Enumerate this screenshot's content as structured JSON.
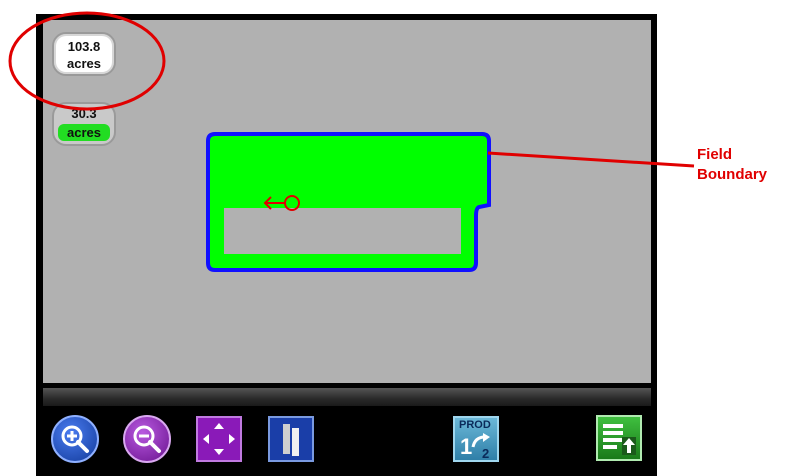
{
  "total_area": {
    "value": "103.8",
    "unit": "acres"
  },
  "covered_area": {
    "value": "30.3",
    "unit": "acres"
  },
  "annotation": {
    "line1": "Field",
    "line2": "Boundary"
  },
  "colors": {
    "map_background": "#b1b1b1",
    "field_fill": "#00ff00",
    "field_boundary": "#1010ff",
    "annotation": "#e00000",
    "zoom_in": "#1a4fc8",
    "zoom_out": "#8a1ab8"
  },
  "toolbar": {
    "zoom_in_icon": "zoom-in-icon",
    "zoom_out_icon": "zoom-out-icon",
    "pan_icon": "pan-arrows-icon",
    "boom_icon": "boom-section-icon",
    "prod_label": "PROD",
    "prod_from": "1",
    "prod_to": "2",
    "menu_icon": "layers-menu-icon"
  }
}
